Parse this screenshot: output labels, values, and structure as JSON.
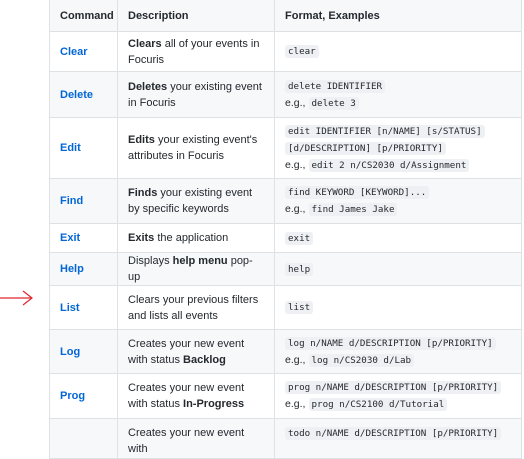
{
  "headers": {
    "command": "Command",
    "description": "Description",
    "format": "Format, Examples"
  },
  "eg_prefix": "e.g.,",
  "rows": [
    {
      "cmd": "Clear",
      "desc_bold": "Clears",
      "desc_rest": " all of your events in Focuris",
      "desc_pre": "",
      "format": "clear",
      "example": ""
    },
    {
      "cmd": "Delete",
      "desc_bold": "Deletes",
      "desc_rest": " your existing event in Focuris",
      "desc_pre": "",
      "format": "delete IDENTIFIER",
      "example": "delete 3"
    },
    {
      "cmd": "Edit",
      "desc_bold": "Edits",
      "desc_rest": " your existing event's attributes in Focuris",
      "desc_pre": "",
      "format_lines": [
        "edit IDENTIFIER [n/NAME] [s/STATUS]",
        "[d/DESCRIPTION] [p/PRIORITY]"
      ],
      "example": "edit 2 n/CS2030 d/Assignment"
    },
    {
      "cmd": "Find",
      "desc_bold": "Finds",
      "desc_rest": " your existing event by specific keywords",
      "desc_pre": "",
      "format": "find KEYWORD [KEYWORD]...",
      "example": "find James Jake"
    },
    {
      "cmd": "Exit",
      "desc_bold": "Exits",
      "desc_rest": " the application",
      "desc_pre": "",
      "format": "exit",
      "example": ""
    },
    {
      "cmd": "Help",
      "desc_pre": "Displays ",
      "desc_bold": "help menu",
      "desc_rest": " pop-up",
      "format": "help",
      "example": ""
    },
    {
      "cmd": "List",
      "desc_pre": "Clears your previous filters and lists all events",
      "desc_bold": "",
      "desc_rest": "",
      "format": "list",
      "example": ""
    },
    {
      "cmd": "Log",
      "desc_pre": "Creates your new event with status ",
      "desc_bold": "Backlog",
      "desc_rest": "",
      "format": "log n/NAME d/DESCRIPTION [p/PRIORITY]",
      "example": "log n/CS2030 d/Lab"
    },
    {
      "cmd": "Prog",
      "desc_pre": "Creates your new event with status ",
      "desc_bold": "In-Progress",
      "desc_rest": "",
      "format": "prog n/NAME d/DESCRIPTION [p/PRIORITY]",
      "example": "prog n/CS2100 d/Tutorial"
    },
    {
      "cmd": "",
      "desc_pre": "Creates your new event with",
      "desc_bold": "",
      "desc_rest": "",
      "format": "todo n/NAME d/DESCRIPTION [p/PRIORITY]",
      "example": ""
    }
  ],
  "colors": {
    "link": "#0366d6",
    "border": "#dfe2e5",
    "stripe": "#f6f8fa",
    "arrow": "#e0262e"
  }
}
